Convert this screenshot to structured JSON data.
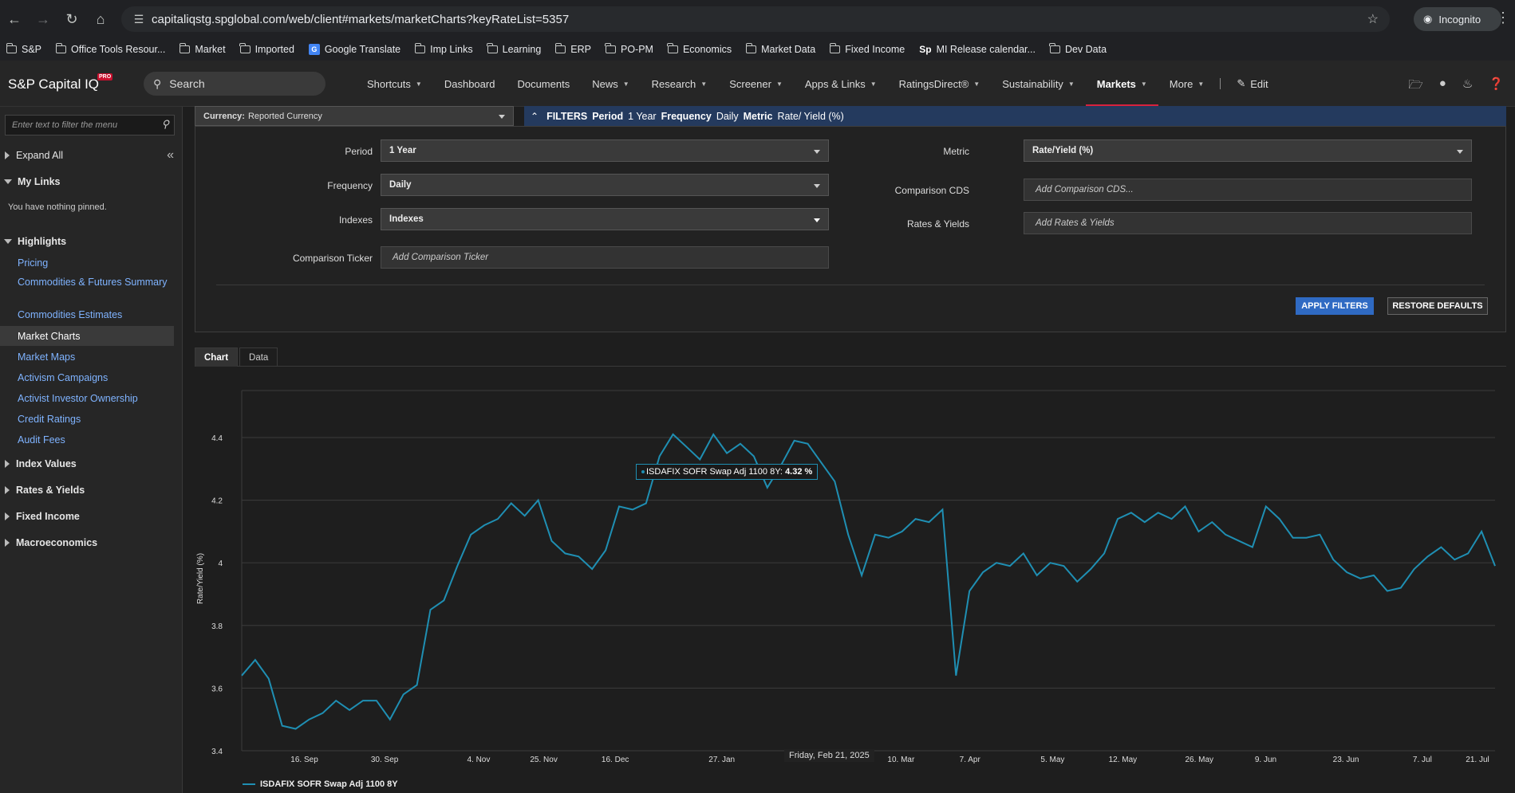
{
  "browser": {
    "url": "capitaliqstg.spglobal.com/web/client#markets/marketCharts?keyRateList=5357",
    "incognito_label": "Incognito",
    "bookmarks": [
      "S&P",
      "Office Tools Resour...",
      "Market",
      "Imported",
      "Google Translate",
      "Imp Links",
      "Learning",
      "ERP",
      "PO-PM",
      "Economics",
      "Market Data",
      "Fixed Income",
      "MI Release calendar...",
      "Dev Data"
    ]
  },
  "header": {
    "logo": "S&P Capital IQ",
    "logo_badge": "PRO",
    "search_placeholder": "Search",
    "nav": [
      {
        "label": "Shortcuts",
        "caret": true
      },
      {
        "label": "Dashboard",
        "caret": false
      },
      {
        "label": "Documents",
        "caret": false
      },
      {
        "label": "News",
        "caret": true
      },
      {
        "label": "Research",
        "caret": true
      },
      {
        "label": "Screener",
        "caret": true
      },
      {
        "label": "Apps & Links",
        "caret": true
      },
      {
        "label": "RatingsDirect®",
        "caret": true
      },
      {
        "label": "Sustainability",
        "caret": true
      },
      {
        "label": "Markets",
        "caret": true,
        "active": true
      },
      {
        "label": "More",
        "caret": true
      }
    ],
    "edit_label": "Edit"
  },
  "sidebar": {
    "filter_placeholder": "Enter text to filter the menu",
    "expand_all": "Expand All",
    "my_links": "My Links",
    "nothing_pinned": "You have nothing pinned.",
    "highlights": "Highlights",
    "highlight_items": [
      "Pricing",
      "Commodities & Futures Summary",
      "Commodities Estimates",
      "Market Charts",
      "Market Maps",
      "Activism Campaigns",
      "Activist Investor Ownership",
      "Credit Ratings",
      "Audit Fees"
    ],
    "sections": [
      "Index Values",
      "Rates & Yields",
      "Fixed Income",
      "Macroeconomics"
    ]
  },
  "filters": {
    "currency_key": "Currency:",
    "currency_value": "Reported Currency",
    "bar_title": "FILTERS",
    "bar_period_key": "Period",
    "bar_period_val": "1 Year",
    "bar_freq_key": "Frequency",
    "bar_freq_val": "Daily",
    "bar_metric_key": "Metric",
    "bar_metric_val": "Rate/ Yield (%)",
    "period_label": "Period",
    "period_value": "1 Year",
    "frequency_label": "Frequency",
    "frequency_value": "Daily",
    "indexes_label": "Indexes",
    "indexes_value": "Indexes",
    "comparison_ticker_label": "Comparison Ticker",
    "comparison_ticker_placeholder": "Add Comparison Ticker",
    "metric_label": "Metric",
    "metric_value": "Rate/Yield (%)",
    "comparison_cds_label": "Comparison CDS",
    "comparison_cds_placeholder": "Add Comparison CDS...",
    "rates_label": "Rates & Yields",
    "rates_placeholder": "Add Rates & Yields",
    "apply": "APPLY FILTERS",
    "restore": "RESTORE DEFAULTS"
  },
  "tabs": [
    "Chart",
    "Data"
  ],
  "chart": {
    "tooltip_series": "ISDAFIX SOFR Swap Adj 1100 8Y:",
    "tooltip_value": "4.32 %",
    "hover_date": "Friday, Feb 21, 2025",
    "line_color": "#1f8fb3"
  },
  "chart_data": {
    "type": "line",
    "ylabel": "Rate/Yield (%)",
    "ylim": [
      3.4,
      4.55
    ],
    "yticks": [
      3.4,
      3.6,
      3.8,
      4,
      4.2,
      4.4
    ],
    "xtick_labels": [
      "16. Sep",
      "30. Sep",
      "4. Nov",
      "25. Nov",
      "16. Dec",
      "27. Jan",
      "10. Mar",
      "7. Apr",
      "5. May",
      "12. May",
      "26. May",
      "9. Jun",
      "23. Jun",
      "7. Jul",
      "21. Jul"
    ],
    "series": [
      {
        "name": "ISDAFIX SOFR Swap Adj 1100 8Y",
        "values": [
          3.64,
          3.69,
          3.63,
          3.48,
          3.47,
          3.5,
          3.52,
          3.56,
          3.53,
          3.56,
          3.56,
          3.5,
          3.58,
          3.61,
          3.85,
          3.88,
          3.99,
          4.09,
          4.12,
          4.14,
          4.19,
          4.15,
          4.2,
          4.07,
          4.03,
          4.02,
          3.98,
          4.04,
          4.18,
          4.17,
          4.19,
          4.34,
          4.41,
          4.37,
          4.33,
          4.41,
          4.35,
          4.38,
          4.34,
          4.24,
          4.31,
          4.39,
          4.38,
          4.32,
          4.26,
          4.09,
          3.96,
          4.09,
          4.08,
          4.1,
          4.14,
          4.13,
          4.17,
          3.64,
          3.91,
          3.97,
          4.0,
          3.99,
          4.03,
          3.96,
          4.0,
          3.99,
          3.94,
          3.98,
          4.03,
          4.14,
          4.16,
          4.13,
          4.16,
          4.14,
          4.18,
          4.1,
          4.13,
          4.09,
          4.07,
          4.05,
          4.18,
          4.14,
          4.08,
          4.08,
          4.09,
          4.01,
          3.97,
          3.95,
          3.96,
          3.91,
          3.92,
          3.98,
          4.02,
          4.05,
          4.01,
          4.03,
          4.1,
          3.99
        ]
      }
    ],
    "legend": "bottom-left",
    "grid": true
  }
}
